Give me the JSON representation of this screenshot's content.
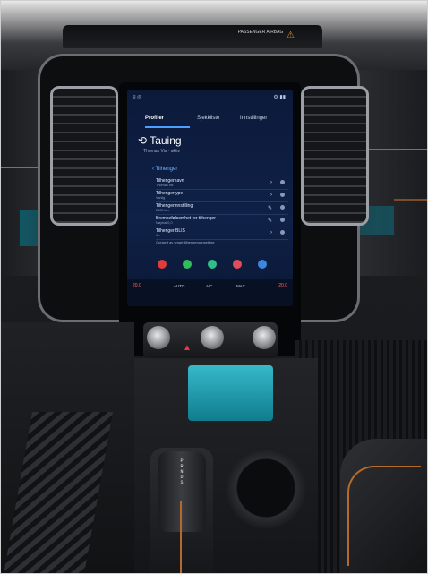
{
  "photo": {
    "subject": "vehicle-center-console",
    "airbag_label": "PASSENGER AIRBAG"
  },
  "screen": {
    "tabs": [
      "Profiler",
      "Sjekkliste",
      "Innstillinger"
    ],
    "feature_title": "Tauing",
    "feature_subtitle": "Thomas Vis · aktiv",
    "section_title": "Tilhenger",
    "rows": [
      {
        "label": "Tilhengernavn",
        "value": "Thomas vis"
      },
      {
        "label": "Tilhengertype",
        "value": "Vanlig"
      },
      {
        "label": "Tilhengerinnstilling",
        "value": "2500 km"
      },
      {
        "label": "Bremsefølsomhet for tilhenger",
        "value": "Nøytral 0,0"
      },
      {
        "label": "Tilhenger BLIS",
        "value": "Av"
      }
    ],
    "note": "Oppsett av smart tilhengeroppsetting",
    "climate": {
      "left_temp": "20,0",
      "right_temp": "20,0",
      "items": [
        "AUTO",
        "A/C",
        "MAX"
      ]
    }
  },
  "gear_selector": {
    "label": "P\nR\nN\nD\nS"
  }
}
